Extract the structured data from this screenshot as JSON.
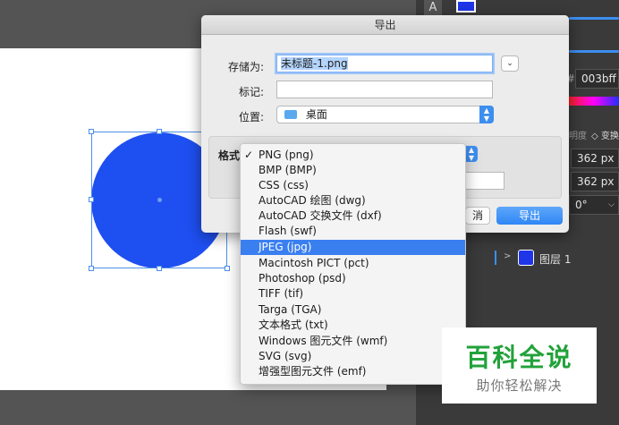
{
  "dialog": {
    "title": "导出",
    "save_as_label": "存储为:",
    "filename": "未标题-1.png",
    "tags_label": "标记:",
    "tags_value": "",
    "location_label": "位置:",
    "location_value": "桌面",
    "format_label": "格式",
    "cancel_label": "消",
    "export_label": "导出"
  },
  "format_menu": {
    "items": [
      "PNG (png)",
      "BMP (BMP)",
      "CSS (css)",
      "AutoCAD 绘图 (dwg)",
      "AutoCAD 交换文件 (dxf)",
      "Flash (swf)",
      "JPEG (jpg)",
      "Macintosh PICT (pct)",
      "Photoshop (psd)",
      "TIFF (tif)",
      "Targa (TGA)",
      "文本格式 (txt)",
      "Windows 图元文件 (wmf)",
      "SVG (svg)",
      "增强型图元文件 (emf)"
    ],
    "checked_index": 0,
    "highlighted_index": 6
  },
  "right_panel": {
    "tool_letter": "A",
    "hex_prefix": "#",
    "hex_value": "003bff",
    "opacity_label": "明度",
    "transform_label": "◇ 变换",
    "width_value": "362 px",
    "height_value": "362 px",
    "rotation_value": "0°",
    "layer_name": "图层 1"
  },
  "watermark": {
    "main": "百科全说",
    "sub": "助你轻松解决"
  },
  "colors": {
    "shape_fill": "#1e4ff0",
    "accent_blue": "#3a7ff0",
    "watermark_green": "#22a23a"
  }
}
